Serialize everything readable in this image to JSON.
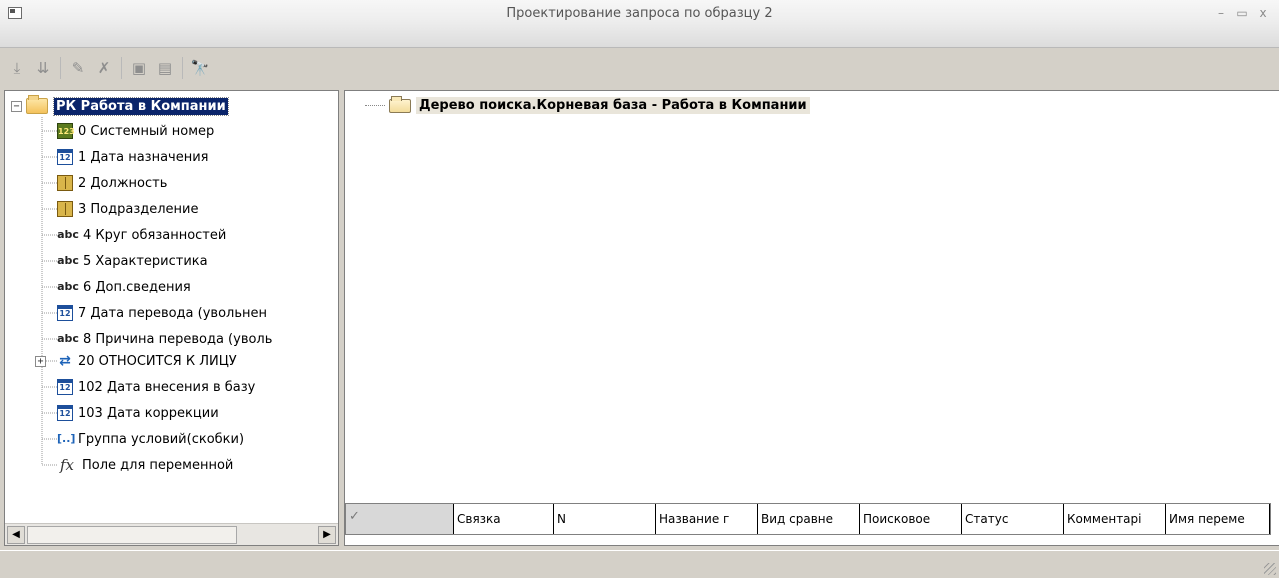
{
  "window": {
    "title": "Проектирование запроса по образцу 2",
    "minimize_glyph": "–",
    "maximize_glyph": "▭",
    "close_glyph": "x"
  },
  "toolbar": {
    "buttons": [
      {
        "icon": "add-condition-icon",
        "glyph": "⤓"
      },
      {
        "icon": "insert-condition-icon",
        "glyph": "⇊"
      },
      {
        "icon": "edit-condition-icon",
        "glyph": "✎"
      },
      {
        "icon": "delete-condition-icon",
        "glyph": "✗"
      },
      {
        "icon": "save-icon",
        "glyph": "▣"
      },
      {
        "icon": "properties-icon",
        "glyph": "▤"
      },
      {
        "icon": "binoculars-icon",
        "glyph": "🔭"
      }
    ]
  },
  "tree": {
    "root": {
      "expander": "−",
      "label": "РК Работа в Компании"
    },
    "items": [
      {
        "icon": "number",
        "glyph": "123",
        "label": "0 Системный номер"
      },
      {
        "icon": "date",
        "glyph": "12",
        "label": "1 Дата назначения"
      },
      {
        "icon": "book",
        "glyph": "",
        "label": "2 Должность"
      },
      {
        "icon": "book",
        "glyph": "",
        "label": "3 Подразделение"
      },
      {
        "icon": "abc",
        "glyph": "abc",
        "label": "4 Круг обязанностей"
      },
      {
        "icon": "abc",
        "glyph": "abc",
        "label": "5 Характеристика"
      },
      {
        "icon": "abc",
        "glyph": "abc",
        "label": "6 Доп.сведения"
      },
      {
        "icon": "date",
        "glyph": "12",
        "label": "7 Дата перевода (увольнен"
      },
      {
        "icon": "abc",
        "glyph": "abc",
        "label": "8 Причина перевода (уволь"
      },
      {
        "icon": "link",
        "glyph": "⇄",
        "label": "20 ОТНОСИТСЯ К ЛИЦУ",
        "expander": "+"
      },
      {
        "icon": "date",
        "glyph": "12",
        "label": "102 Дата внесения в базу"
      },
      {
        "icon": "date",
        "glyph": "12",
        "label": "103 Дата коррекции"
      },
      {
        "icon": "group",
        "glyph": "[..]",
        "label": "Группа условий(скобки)"
      },
      {
        "icon": "fx",
        "glyph": "fx",
        "label": "Поле для переменной"
      }
    ]
  },
  "scrollbar": {
    "left_arrow": "◀",
    "right_arrow": "▶"
  },
  "search_tree": {
    "root_label": "Дерево поиска.Корневая база - Работа в Компании"
  },
  "grid": {
    "check_glyph": "✓",
    "columns": [
      "Связка",
      "N",
      "Название г",
      "Вид сравне",
      "Поисковое",
      "Статус",
      "Комментарі",
      "Имя переме"
    ]
  }
}
